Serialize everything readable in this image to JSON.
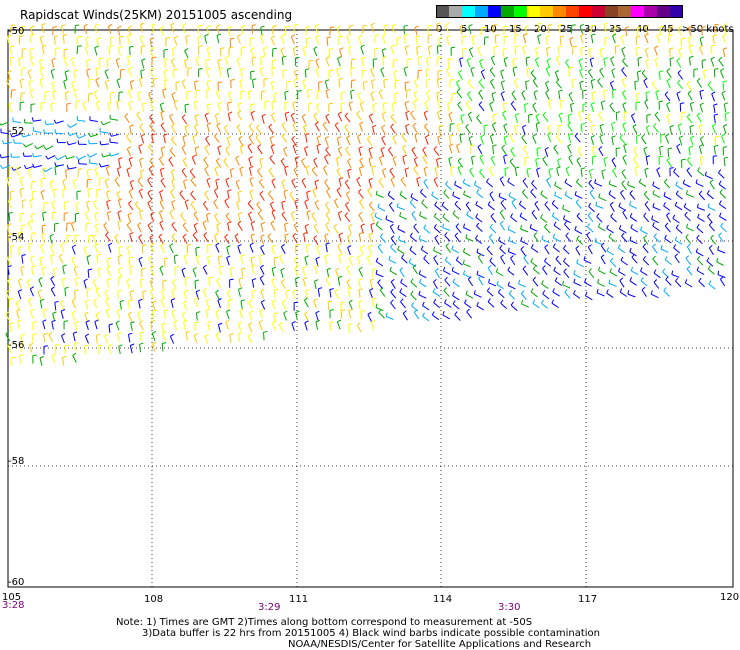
{
  "title": "Rapidscat Winds(25KM) 20151005 ascending",
  "colorbar": {
    "labels": [
      "0",
      "5",
      "10",
      "15",
      "20",
      "25",
      "30",
      "35",
      "40",
      "45",
      ">50 knots"
    ],
    "colors": [
      "#555555",
      "#aaaaaa",
      "#00ffff",
      "#00aaff",
      "#0000ff",
      "#00aa00",
      "#00ff00",
      "#ffff00",
      "#ffcc00",
      "#ff8800",
      "#ff4400",
      "#ff0000",
      "#cc0033",
      "#884422",
      "#aa6633",
      "#ff00ff",
      "#aa00aa",
      "#660088",
      "#3300aa"
    ]
  },
  "lat_labels": [
    "-50",
    "-52",
    "-54",
    "-56",
    "-58",
    "-60"
  ],
  "lon_labels": [
    "105",
    "108",
    "111",
    "114",
    "117",
    "120"
  ],
  "time_labels": [
    "3:28",
    "3:29",
    "3:30"
  ],
  "notes": {
    "line1": "Note: 1) Times are GMT 2)Times along bottom correspond to measurement at -50S",
    "line2": "3)Data buffer is 22 hrs from 20151005 4) Black wind barbs indicate possible contamination",
    "line3": "NOAA/NESDIS/Center for Satellite Applications and Research"
  },
  "wind_colors": {
    "blue": "#0000ff",
    "cyan": "#00aaff",
    "green": "#00aa00",
    "ltgreen": "#00ff00",
    "yellow": "#ffff00",
    "gold": "#ffcc00",
    "orange": "#ff8800",
    "red": "#ff2200",
    "black": "#000000"
  }
}
